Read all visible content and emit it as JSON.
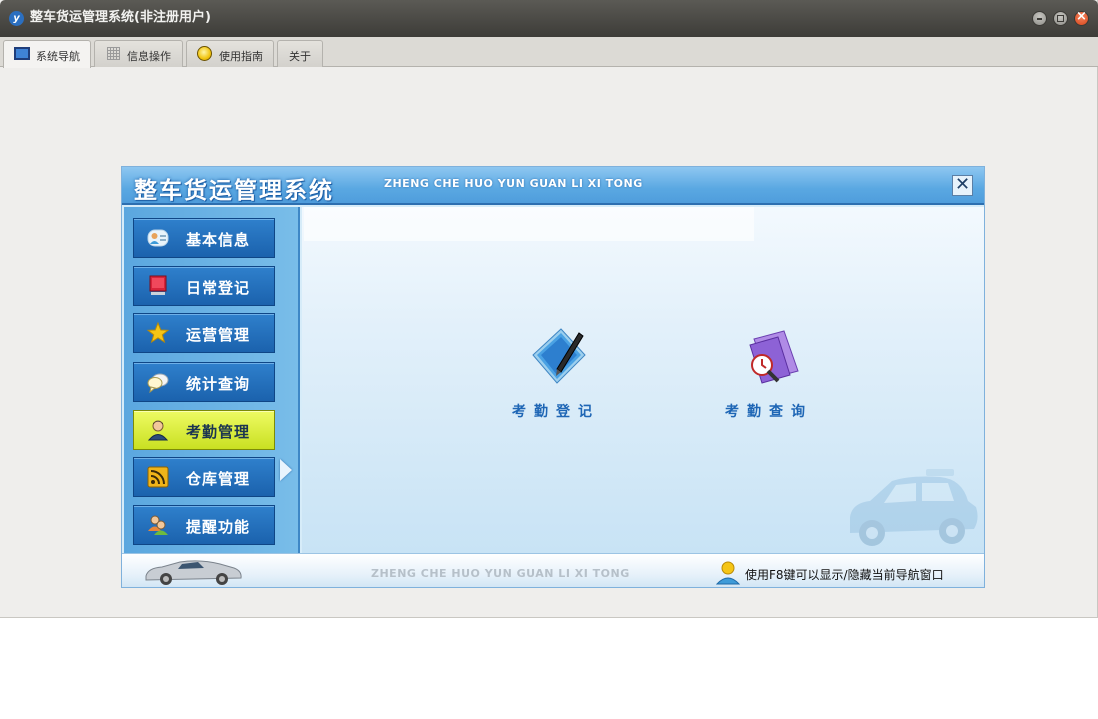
{
  "window": {
    "title": "整车货运管理系统(非注册用户)"
  },
  "tabs": [
    {
      "label": "系统导航",
      "icon": "monitor-icon",
      "active": true
    },
    {
      "label": "信息操作",
      "icon": "grid-icon",
      "active": false
    },
    {
      "label": "使用指南",
      "icon": "bulb-icon",
      "active": false
    },
    {
      "label": "关于",
      "icon": "",
      "active": false
    }
  ],
  "nav_panel": {
    "title": "整车货运管理系统",
    "subtitle": "ZHENG CHE HUO YUN GUAN LI XI TONG",
    "menu": [
      {
        "label": "基本信息",
        "icon": "id-card-icon",
        "active": false
      },
      {
        "label": "日常登记",
        "icon": "monitor-icon",
        "active": false
      },
      {
        "label": "运营管理",
        "icon": "star-icon",
        "active": false
      },
      {
        "label": "统计查询",
        "icon": "chat-bubble-icon",
        "active": false
      },
      {
        "label": "考勤管理",
        "icon": "user-icon",
        "active": true
      },
      {
        "label": "仓库管理",
        "icon": "rss-icon",
        "active": false
      },
      {
        "label": "提醒功能",
        "icon": "users-icon",
        "active": false
      }
    ],
    "functions": [
      {
        "label": "考勤登记",
        "icon": "pen-document-icon"
      },
      {
        "label": "考勤查询",
        "icon": "clock-search-icon"
      }
    ],
    "footer": {
      "center_text": "ZHENG CHE HUO YUN GUAN LI XI TONG",
      "hint": "使用F8键可以显示/隐藏当前导航窗口"
    }
  },
  "colors": {
    "active_menu": "#dff23f",
    "menu_button": "#2574c0",
    "header_blue": "#5aa8e2",
    "function_label": "#1e66b5"
  }
}
